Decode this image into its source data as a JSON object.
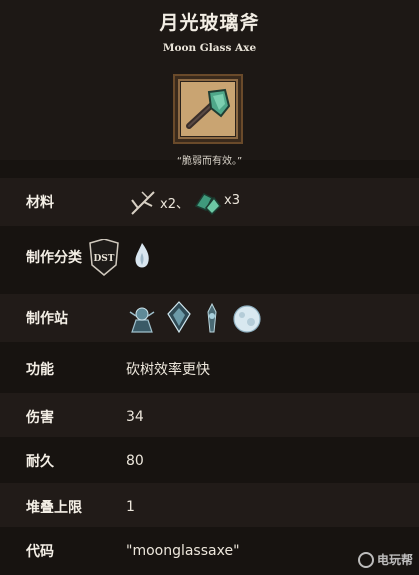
{
  "title": "月光玻璃斧",
  "subtitle": "Moon Glass Axe",
  "quote": "“脆弱而有效。”",
  "rows": {
    "materials": {
      "label": "材料",
      "twigs_count": "x2、",
      "glass_count": "x3"
    },
    "category": {
      "label": "制作分类"
    },
    "station": {
      "label": "制作站"
    },
    "function": {
      "label": "功能",
      "value": "砍树效率更快"
    },
    "damage": {
      "label": "伤害",
      "value": "34"
    },
    "durability": {
      "label": "耐久",
      "value": "80"
    },
    "stack": {
      "label": "堆叠上限",
      "value": "1"
    },
    "code": {
      "label": "代码",
      "value": "\"moonglassaxe\""
    }
  },
  "watermark": {
    "text": "电玩帮"
  },
  "colors": {
    "background": "#171310",
    "row_alt": "#211b18",
    "text": "#ece6db",
    "frame": "#8d6a44",
    "glass": "#4fa88a"
  },
  "icons": [
    "moon-glass-axe-icon",
    "twigs-icon",
    "moon-glass-icon",
    "dst-badge-icon",
    "celestial-flame-icon",
    "celestial-altar-icon",
    "celestial-sanctum-icon",
    "celestial-tribute-icon",
    "moon-orb-icon"
  ]
}
